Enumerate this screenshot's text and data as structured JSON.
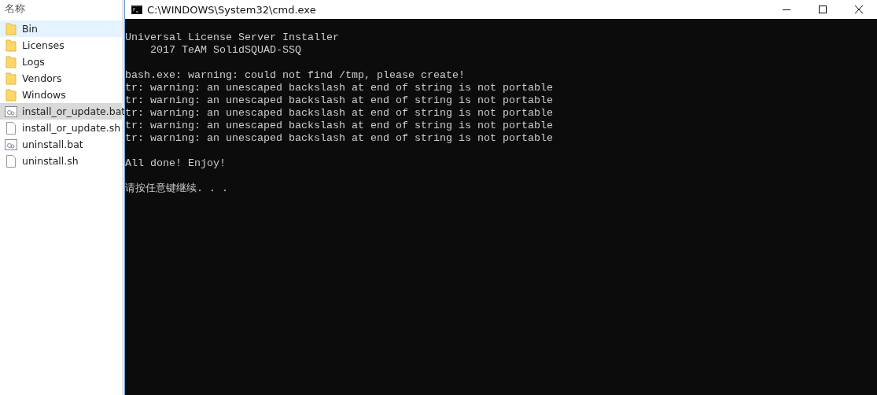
{
  "explorer": {
    "column_header": "名称",
    "items": [
      {
        "name": "Bin",
        "kind": "folder",
        "selected": false,
        "hovered": true
      },
      {
        "name": "Licenses",
        "kind": "folder",
        "selected": false,
        "hovered": false
      },
      {
        "name": "Logs",
        "kind": "folder",
        "selected": false,
        "hovered": false
      },
      {
        "name": "Vendors",
        "kind": "folder",
        "selected": false,
        "hovered": false
      },
      {
        "name": "Windows",
        "kind": "folder",
        "selected": false,
        "hovered": false
      },
      {
        "name": "install_or_update.bat",
        "kind": "batch",
        "selected": true,
        "hovered": false
      },
      {
        "name": "install_or_update.sh",
        "kind": "file",
        "selected": false,
        "hovered": false
      },
      {
        "name": "uninstall.bat",
        "kind": "batch",
        "selected": false,
        "hovered": false
      },
      {
        "name": "uninstall.sh",
        "kind": "file",
        "selected": false,
        "hovered": false
      }
    ]
  },
  "console": {
    "title": "C:\\WINDOWS\\System32\\cmd.exe",
    "paragraphs": [
      [
        "Universal License Server Installer",
        "    2017 TeAM SolidSQUAD-SSQ"
      ],
      [
        "bash.exe: warning: could not find /tmp, please create!",
        "tr: warning: an unescaped backslash at end of string is not portable",
        "tr: warning: an unescaped backslash at end of string is not portable",
        "tr: warning: an unescaped backslash at end of string is not portable",
        "tr: warning: an unescaped backslash at end of string is not portable",
        "tr: warning: an unescaped backslash at end of string is not portable"
      ],
      [
        "All done! Enjoy!"
      ],
      [
        "请按任意键继续. . ."
      ]
    ]
  }
}
